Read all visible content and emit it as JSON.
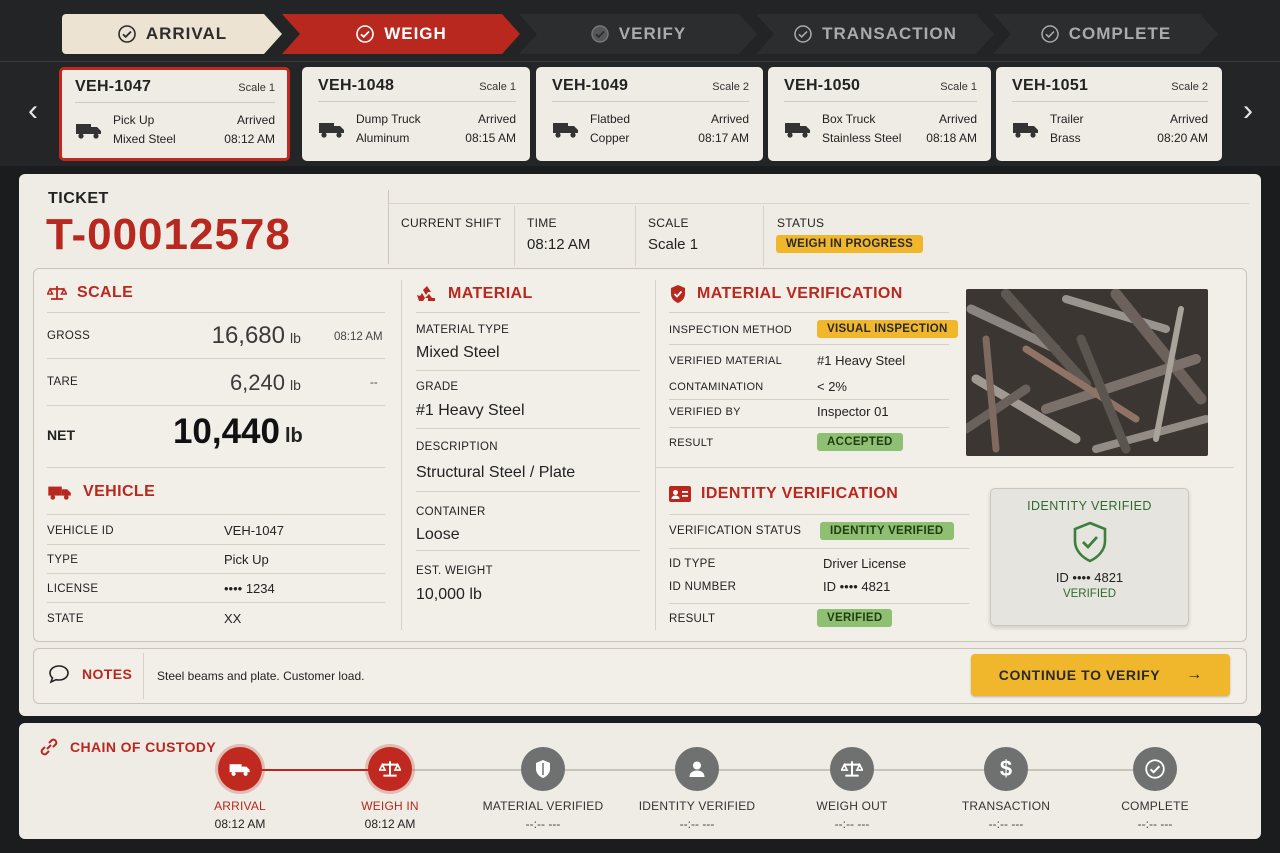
{
  "steps": [
    {
      "label": "ARRIVAL",
      "state": "done"
    },
    {
      "label": "WEIGH",
      "state": "active"
    },
    {
      "label": "VERIFY",
      "state": "todo"
    },
    {
      "label": "TRANSACTION",
      "state": "todo"
    },
    {
      "label": "COMPLETE",
      "state": "todo"
    }
  ],
  "vehicles": [
    {
      "id": "VEH-1047",
      "scale": "Scale 1",
      "type": "Pick Up",
      "material": "Mixed Steel",
      "status": "Arrived",
      "time": "08:12 AM"
    },
    {
      "id": "VEH-1048",
      "scale": "Scale 1",
      "type": "Dump Truck",
      "material": "Aluminum",
      "status": "Arrived",
      "time": "08:15 AM"
    },
    {
      "id": "VEH-1049",
      "scale": "Scale 2",
      "type": "Flatbed",
      "material": "Copper",
      "status": "Arrived",
      "time": "08:17 AM"
    },
    {
      "id": "VEH-1050",
      "scale": "Scale 1",
      "type": "Box Truck",
      "material": "Stainless Steel",
      "status": "Arrived",
      "time": "08:18 AM"
    },
    {
      "id": "VEH-1051",
      "scale": "Scale 2",
      "type": "Trailer",
      "material": "Brass",
      "status": "Arrived",
      "time": "08:20 AM"
    }
  ],
  "ticket": {
    "label": "TICKET",
    "number": "T-00012578",
    "shift_label": "CURRENT SHIFT",
    "time_label": "TIME",
    "time": "08:12 AM",
    "scale_label": "SCALE",
    "scale": "Scale 1",
    "status_label": "STATUS",
    "status": "WEIGH IN PROGRESS"
  },
  "scale": {
    "title": "SCALE",
    "gross_label": "GROSS",
    "gross": "16,680",
    "gross_unit": "lb",
    "gross_time": "08:12 AM",
    "tare_label": "TARE",
    "tare": "6,240",
    "tare_unit": "lb",
    "tare_time": "--",
    "net_label": "NET",
    "net": "10,440",
    "net_unit": "lb"
  },
  "vehicle": {
    "title": "VEHICLE",
    "rows": [
      {
        "label": "VEHICLE ID",
        "value": "VEH-1047"
      },
      {
        "label": "TYPE",
        "value": "Pick Up"
      },
      {
        "label": "LICENSE",
        "value": "•••• 1234"
      },
      {
        "label": "STATE",
        "value": "XX"
      }
    ]
  },
  "material": {
    "title": "MATERIAL",
    "rows": [
      {
        "label": "MATERIAL TYPE",
        "value": "Mixed Steel"
      },
      {
        "label": "GRADE",
        "value": "#1 Heavy Steel"
      },
      {
        "label": "DESCRIPTION",
        "value": "Structural Steel / Plate"
      },
      {
        "label": "CONTAINER",
        "value": "Loose"
      },
      {
        "label": "EST. WEIGHT",
        "value": "10,000 lb"
      }
    ]
  },
  "verification": {
    "title": "MATERIAL VERIFICATION",
    "method_label": "INSPECTION METHOD",
    "method": "VISUAL INSPECTION",
    "verified_label": "VERIFIED MATERIAL",
    "verified": "#1 Heavy Steel",
    "contam_label": "CONTAMINATION",
    "contam": "< 2%",
    "by_label": "VERIFIED BY",
    "by": "Inspector 01",
    "result_label": "RESULT",
    "result": "ACCEPTED"
  },
  "identity": {
    "title": "IDENTITY VERIFICATION",
    "status_label": "VERIFICATION STATUS",
    "status": "IDENTITY VERIFIED",
    "idtype_label": "ID TYPE",
    "idtype": "Driver License",
    "idnum_label": "ID NUMBER",
    "idnum": "ID •••• 4821",
    "result_label": "RESULT",
    "result": "VERIFIED",
    "card_title": "IDENTITY VERIFIED",
    "card_id": "ID •••• 4821",
    "card_status": "VERIFIED"
  },
  "notes": {
    "title": "NOTES",
    "text": "Steel beams and plate. Customer load.",
    "button": "CONTINUE TO VERIFY"
  },
  "custody": {
    "title": "CHAIN OF CUSTODY",
    "nodes": [
      {
        "label": "ARRIVAL",
        "time": "08:12 AM",
        "state": "done",
        "icon": "truck-icon"
      },
      {
        "label": "WEIGH IN",
        "time": "08:12 AM",
        "state": "done",
        "icon": "scale-icon"
      },
      {
        "label": "MATERIAL VERIFIED",
        "time": "--:-- ---",
        "state": "todo",
        "icon": "shield-icon"
      },
      {
        "label": "IDENTITY VERIFIED",
        "time": "--:-- ---",
        "state": "todo",
        "icon": "person-icon"
      },
      {
        "label": "WEIGH OUT",
        "time": "--:-- ---",
        "state": "todo",
        "icon": "scale-icon"
      },
      {
        "label": "TRANSACTION",
        "time": "--:-- ---",
        "state": "todo",
        "icon": "dollar-icon"
      },
      {
        "label": "COMPLETE",
        "time": "--:-- ---",
        "state": "todo",
        "icon": "check-icon"
      }
    ]
  },
  "colors": {
    "accent": "#b8281e",
    "warning": "#f1b72c",
    "success": "#8fbf73"
  }
}
